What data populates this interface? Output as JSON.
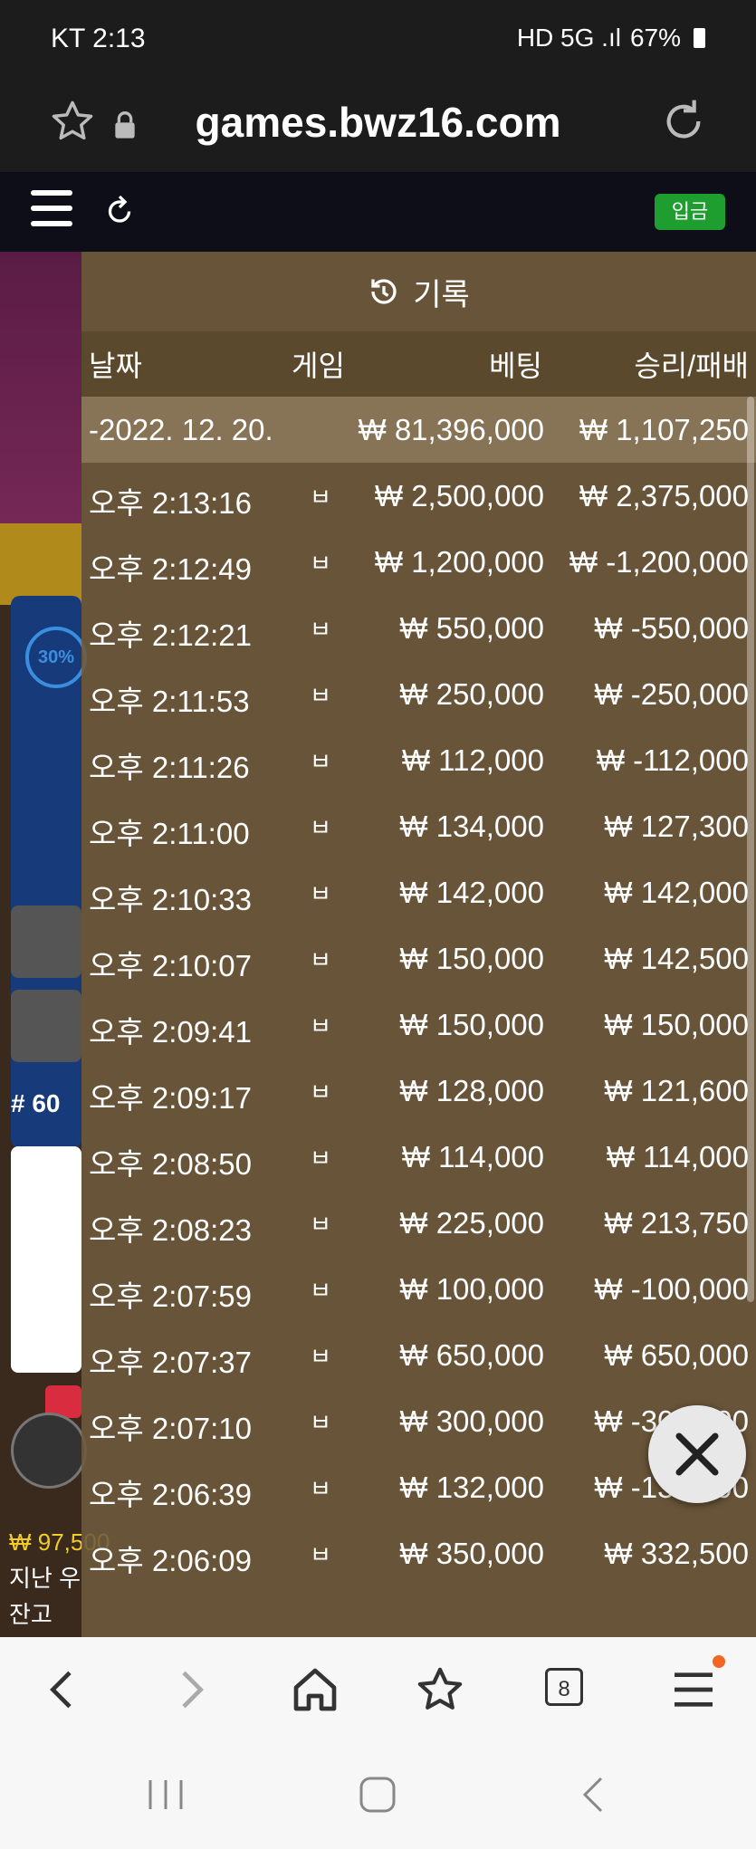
{
  "status_bar": {
    "carrier_time": "KT  2:13",
    "indicators": "HD 5G .ıl",
    "battery": "67%"
  },
  "url_bar": {
    "url": "games.bwz16.com"
  },
  "site_header": {
    "deposit_label": "입금"
  },
  "background": {
    "progress_pct": "30%",
    "round": "# 60",
    "balance_line": "₩ 97,500",
    "label_prev": "지난 우",
    "label_balance": "잔고"
  },
  "history": {
    "title": "기록",
    "columns": [
      "날짜",
      "게임",
      "베팅",
      "승리/패배"
    ],
    "summary": {
      "date": "-2022. 12. 20.",
      "bet": "₩ 81,396,000",
      "result": "₩ 1,107,250"
    },
    "rows": [
      {
        "time": "오후 2:13:16",
        "game": "ㅂ",
        "bet": "₩ 2,500,000",
        "result": "₩ 2,375,000"
      },
      {
        "time": "오후 2:12:49",
        "game": "ㅂ",
        "bet": "₩ 1,200,000",
        "result": "₩ -1,200,000"
      },
      {
        "time": "오후 2:12:21",
        "game": "ㅂ",
        "bet": "₩ 550,000",
        "result": "₩ -550,000"
      },
      {
        "time": "오후 2:11:53",
        "game": "ㅂ",
        "bet": "₩ 250,000",
        "result": "₩ -250,000"
      },
      {
        "time": "오후 2:11:26",
        "game": "ㅂ",
        "bet": "₩ 112,000",
        "result": "₩ -112,000"
      },
      {
        "time": "오후 2:11:00",
        "game": "ㅂ",
        "bet": "₩ 134,000",
        "result": "₩ 127,300"
      },
      {
        "time": "오후 2:10:33",
        "game": "ㅂ",
        "bet": "₩ 142,000",
        "result": "₩ 142,000"
      },
      {
        "time": "오후 2:10:07",
        "game": "ㅂ",
        "bet": "₩ 150,000",
        "result": "₩ 142,500"
      },
      {
        "time": "오후 2:09:41",
        "game": "ㅂ",
        "bet": "₩ 150,000",
        "result": "₩ 150,000"
      },
      {
        "time": "오후 2:09:17",
        "game": "ㅂ",
        "bet": "₩ 128,000",
        "result": "₩ 121,600"
      },
      {
        "time": "오후 2:08:50",
        "game": "ㅂ",
        "bet": "₩ 114,000",
        "result": "₩ 114,000"
      },
      {
        "time": "오후 2:08:23",
        "game": "ㅂ",
        "bet": "₩ 225,000",
        "result": "₩ 213,750"
      },
      {
        "time": "오후 2:07:59",
        "game": "ㅂ",
        "bet": "₩ 100,000",
        "result": "₩ -100,000"
      },
      {
        "time": "오후 2:07:37",
        "game": "ㅂ",
        "bet": "₩ 650,000",
        "result": "₩ 650,000"
      },
      {
        "time": "오후 2:07:10",
        "game": "ㅂ",
        "bet": "₩ 300,000",
        "result": "₩ -300,000"
      },
      {
        "time": "오후 2:06:39",
        "game": "ㅂ",
        "bet": "₩ 132,000",
        "result": "₩ -132,000"
      },
      {
        "time": "오후 2:06:09",
        "game": "ㅂ",
        "bet": "₩ 350,000",
        "result": "₩ 332,500"
      }
    ]
  },
  "browser_nav": {
    "tab_count": "8"
  }
}
